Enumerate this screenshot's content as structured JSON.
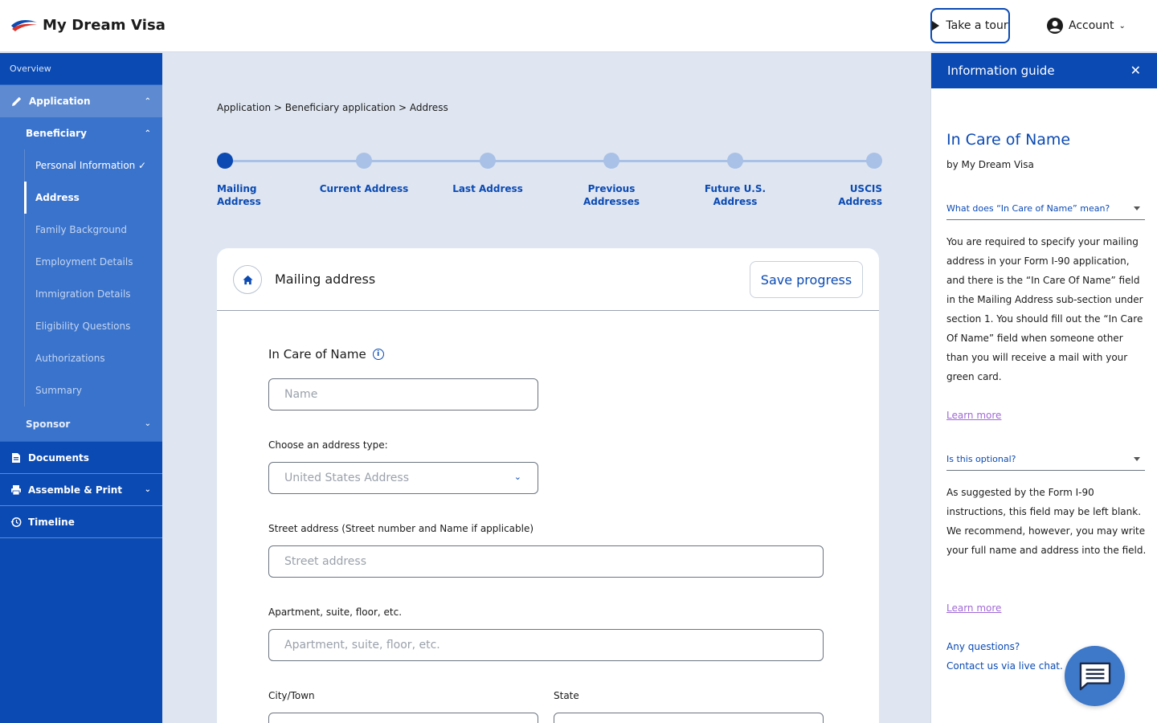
{
  "header": {
    "brand": "My Dream Visa",
    "tour_label": "Take a tour",
    "account_label": "Account",
    "colors": {
      "primary": "#0b4ab3",
      "logo_red": "#d9322b"
    }
  },
  "sidebar": {
    "overview": "Overview",
    "application": "Application",
    "beneficiary": "Beneficiary",
    "sub_items": [
      {
        "label": "Personal Information",
        "state": "done"
      },
      {
        "label": "Address",
        "state": "active"
      },
      {
        "label": "Family Background",
        "state": "todo"
      },
      {
        "label": "Employment Details",
        "state": "todo"
      },
      {
        "label": "Immigration Details",
        "state": "todo"
      },
      {
        "label": "Eligibility Questions",
        "state": "todo"
      },
      {
        "label": "Authorizations",
        "state": "todo"
      },
      {
        "label": "Summary",
        "state": "todo"
      }
    ],
    "sponsor": "Sponsor",
    "documents": "Documents",
    "assemble": "Assemble & Print",
    "timeline": "Timeline"
  },
  "main": {
    "breadcrumb": "Application > Beneficiary application > Address",
    "steps": [
      {
        "line1": "Mailing",
        "line2": "Address",
        "active": true
      },
      {
        "line1": "Current Address",
        "line2": "",
        "active": false
      },
      {
        "line1": "Last Address",
        "line2": "",
        "active": false
      },
      {
        "line1": "Previous",
        "line2": "Addresses",
        "active": false
      },
      {
        "line1": "Future U.S.",
        "line2": "Address",
        "active": false
      },
      {
        "line1": "USCIS",
        "line2": "Address",
        "active": false
      }
    ],
    "card": {
      "title": "Mailing address",
      "save_label": "Save progress",
      "in_care_label": "In Care of Name",
      "name_placeholder": "Name",
      "address_type_label": "Choose an address type:",
      "address_type_value": "United States Address",
      "street_label": "Street address (Street number and Name if applicable)",
      "street_placeholder": "Street address",
      "apt_label": "Apartment, suite, floor, etc.",
      "apt_placeholder": "Apartment, suite, floor, etc.",
      "city_label": "City/Town",
      "state_label": "State"
    }
  },
  "panel": {
    "heading": "Information guide",
    "title": "In Care of Name",
    "by": "by My Dream Visa",
    "q1": "What does “In Care of Name” mean?",
    "a1": "You are required to specify your mailing address in your Form I-90 application, and there is the “In Care Of Name” field in the Mailing Address sub-section under section 1. You should fill out the “In Care Of Name” field when someone other than you will receive a mail with your green card.",
    "learn_more_1": "Learn more",
    "q2": "Is this optional?",
    "a2": "As suggested by the Form I-90 instructions, this field may be left blank. We recommend, however, you may write your full name  and address into the field.",
    "learn_more_2": "Learn more",
    "questions": "Any questions?",
    "contact": "Contact us via live chat."
  }
}
